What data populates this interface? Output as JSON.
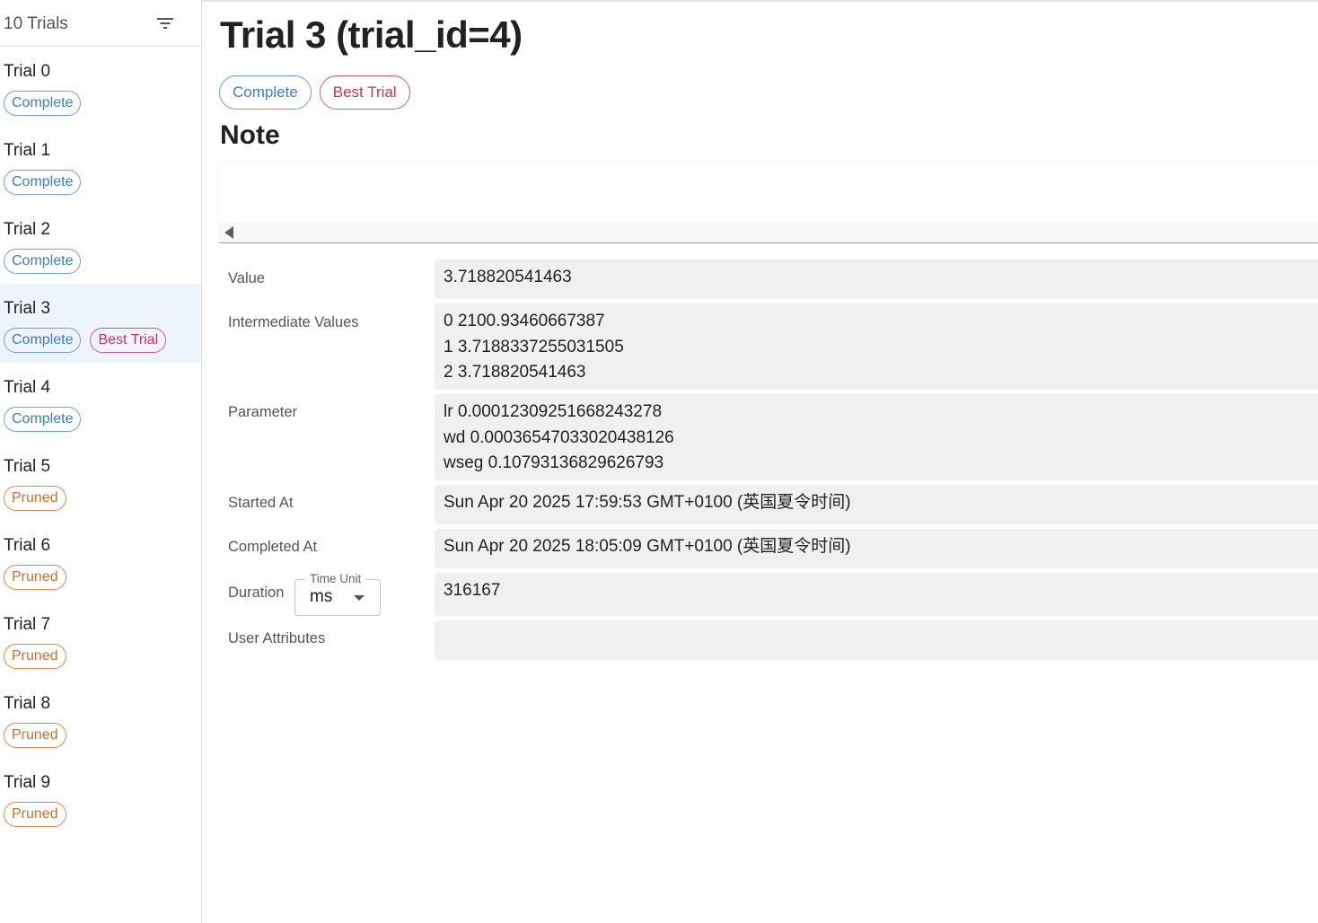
{
  "sidebar": {
    "header": {
      "count_label": "10 Trials",
      "filter_icon": "filter-icon"
    },
    "trials": [
      {
        "name": "Trial 0",
        "chips": [
          {
            "label": "Complete",
            "kind": "complete"
          }
        ]
      },
      {
        "name": "Trial 1",
        "chips": [
          {
            "label": "Complete",
            "kind": "complete"
          }
        ]
      },
      {
        "name": "Trial 2",
        "chips": [
          {
            "label": "Complete",
            "kind": "complete"
          }
        ]
      },
      {
        "name": "Trial 3",
        "chips": [
          {
            "label": "Complete",
            "kind": "complete"
          },
          {
            "label": "Best Trial",
            "kind": "best"
          }
        ],
        "selected": true
      },
      {
        "name": "Trial 4",
        "chips": [
          {
            "label": "Complete",
            "kind": "complete"
          }
        ]
      },
      {
        "name": "Trial 5",
        "chips": [
          {
            "label": "Pruned",
            "kind": "pruned"
          }
        ]
      },
      {
        "name": "Trial 6",
        "chips": [
          {
            "label": "Pruned",
            "kind": "pruned"
          }
        ]
      },
      {
        "name": "Trial 7",
        "chips": [
          {
            "label": "Pruned",
            "kind": "pruned"
          }
        ]
      },
      {
        "name": "Trial 8",
        "chips": [
          {
            "label": "Pruned",
            "kind": "pruned"
          }
        ]
      },
      {
        "name": "Trial 9",
        "chips": [
          {
            "label": "Pruned",
            "kind": "pruned"
          }
        ]
      }
    ]
  },
  "main": {
    "title": "Trial 3 (trial_id=4)",
    "chips": {
      "complete": "Complete",
      "best": "Best Trial"
    },
    "note": {
      "heading": "Note",
      "content": ""
    },
    "details": {
      "value": {
        "label": "Value",
        "value": "3.718820541463"
      },
      "intermediate": {
        "label": "Intermediate Values",
        "lines": [
          "0 2100.93460667387",
          "1 3.7188337255031505",
          "2 3.718820541463"
        ]
      },
      "parameter": {
        "label": "Parameter",
        "lines": [
          "lr 0.00012309251668243278",
          "wd 0.00036547033020438126",
          "wseg 0.10793136829626793"
        ]
      },
      "started": {
        "label": "Started At",
        "value": "Sun Apr 20 2025 17:59:53 GMT+0100 (英国夏令时间)"
      },
      "completed": {
        "label": "Completed At",
        "value": "Sun Apr 20 2025 18:05:09 GMT+0100 (英国夏令时间)"
      },
      "duration": {
        "label": "Duration",
        "unit_legend": "Time Unit",
        "unit_value": "ms",
        "value": "316167"
      },
      "user_attributes": {
        "label": "User Attributes",
        "value": ""
      }
    }
  },
  "colors": {
    "complete": "#3d7ec7",
    "best": "#c7345e",
    "pruned": "#d06f2e",
    "selected_bg": "#eef4fb",
    "value_bg": "#f0f0f0"
  }
}
